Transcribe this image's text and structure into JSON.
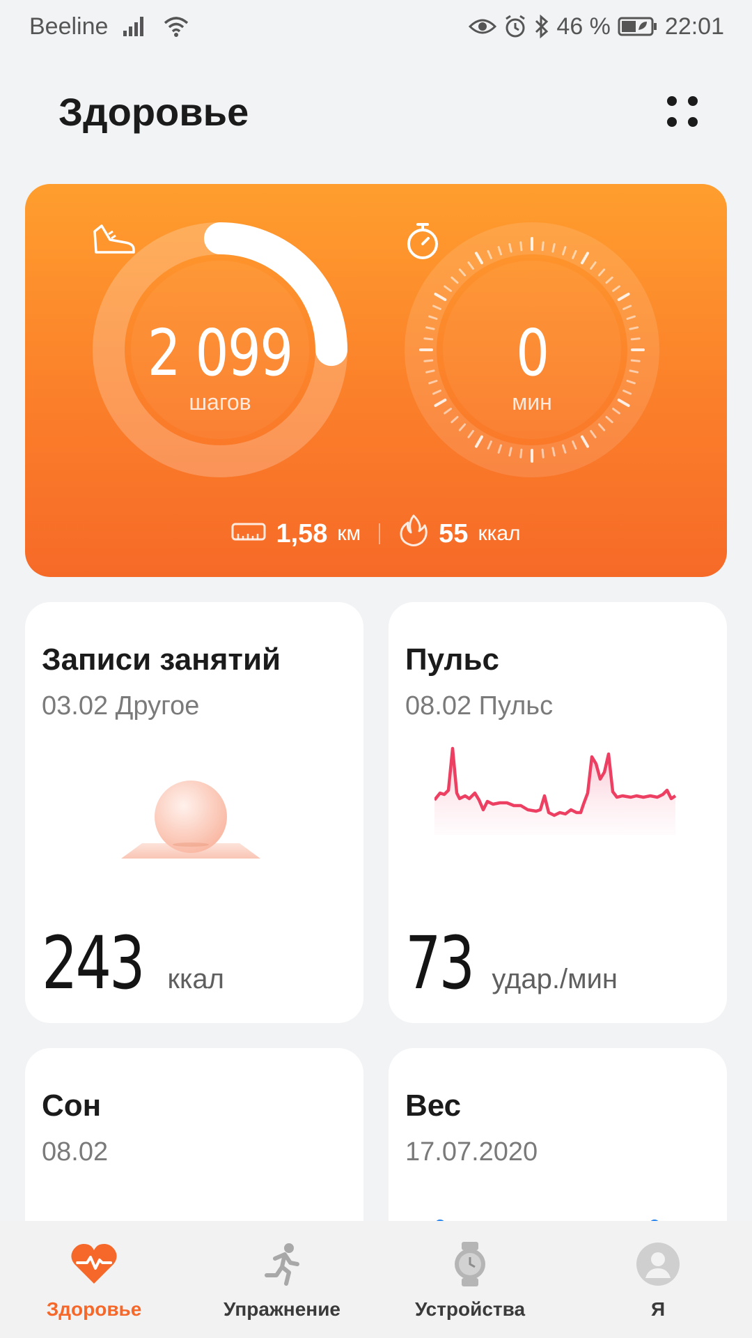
{
  "status_bar": {
    "carrier": "Beeline",
    "battery_percent": "46 %",
    "time": "22:01"
  },
  "header": {
    "title": "Здоровье"
  },
  "summary": {
    "steps": {
      "value": "2 099",
      "unit": "шагов",
      "progress": 0.25
    },
    "active": {
      "value": "0",
      "unit": "мин"
    },
    "distance": {
      "value": "1,58",
      "unit": "км"
    },
    "calories": {
      "value": "55",
      "unit": "ккал"
    },
    "colors": {
      "card_top": "#ff9e2e",
      "card_bottom": "#f66a28"
    }
  },
  "tiles": {
    "workouts": {
      "title": "Записи занятий",
      "subtitle": "03.02 Другое",
      "value": "243",
      "unit": "ккал"
    },
    "pulse": {
      "title": "Пульс",
      "subtitle": "08.02 Пульс",
      "value": "73",
      "unit": "удар./мин",
      "color": "#ec3f62"
    },
    "sleep": {
      "title": "Сон",
      "subtitle": "08.02"
    },
    "weight": {
      "title": "Вес",
      "subtitle": "17.07.2020"
    }
  },
  "bottom_nav": {
    "items": [
      {
        "label": "Здоровье",
        "icon": "heart-pulse-icon",
        "active": true
      },
      {
        "label": "Упражнение",
        "icon": "running-icon",
        "active": false
      },
      {
        "label": "Устройства",
        "icon": "watch-icon",
        "active": false
      },
      {
        "label": "Я",
        "icon": "profile-icon",
        "active": false
      }
    ],
    "accent": "#f5682a"
  }
}
